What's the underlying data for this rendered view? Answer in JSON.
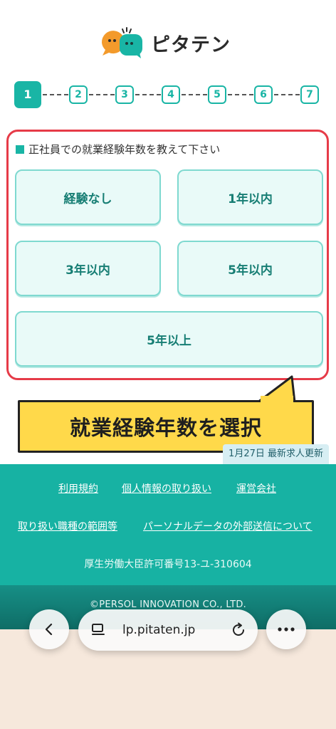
{
  "brand": {
    "name": "ピタテン"
  },
  "steps": [
    "1",
    "2",
    "3",
    "4",
    "5",
    "6",
    "7"
  ],
  "question": {
    "title": "正社員での就業経験年数を教えて下さい",
    "options": [
      "経験なし",
      "1年以内",
      "3年以内",
      "5年以内",
      "5年以上"
    ]
  },
  "callout": {
    "text": "就業経験年数を選択"
  },
  "update_badge": "1月27日 最新求人更新",
  "footer": {
    "links_row1": [
      "利用規約",
      "個人情報の取り扱い",
      "運営会社"
    ],
    "links_row2": [
      "取り扱い職種の範囲等",
      "パーソナルデータの外部送信について"
    ],
    "license": "厚生労働大臣許可番号13-ユ-310604",
    "copyright": "©PERSOL INNOVATION CO., LTD."
  },
  "browser": {
    "url": "lp.pitaten.jp"
  },
  "colors": {
    "accent": "#19b5a5",
    "highlight": "#e63b48",
    "callout": "#ffd94a"
  }
}
